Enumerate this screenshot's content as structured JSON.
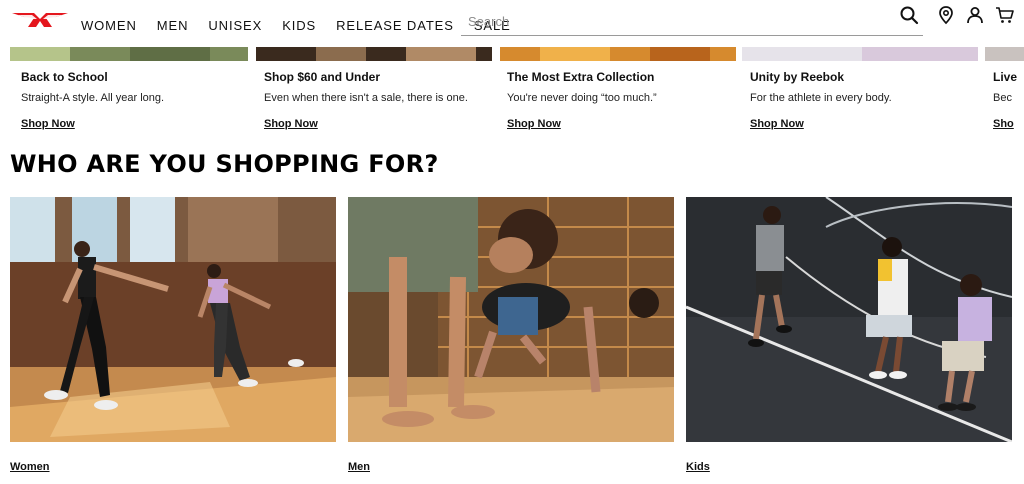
{
  "brand": {
    "logo_alt": "Reebok",
    "accent": "#e4161d"
  },
  "nav": {
    "items": [
      {
        "label": "WOMEN"
      },
      {
        "label": "MEN"
      },
      {
        "label": "UNISEX"
      },
      {
        "label": "KIDS"
      },
      {
        "label": "RELEASE DATES"
      },
      {
        "label": "SALE"
      }
    ]
  },
  "search": {
    "placeholder": "Search",
    "value": ""
  },
  "header_icons": [
    "search-icon",
    "location-pin-icon",
    "user-icon",
    "cart-icon"
  ],
  "collections": [
    {
      "title": "Back to School",
      "subtitle": "Straight-A style. All year long.",
      "link": "Shop Now"
    },
    {
      "title": "Shop $60 and Under",
      "subtitle": "Even when there isn't a sale, there is one.",
      "link": "Shop Now"
    },
    {
      "title": "The Most Extra Collection",
      "subtitle": "You're never doing “too much.”",
      "link": "Shop Now"
    },
    {
      "title": "Unity by Reebok",
      "subtitle": "For the athlete in every body.",
      "link": "Shop Now"
    },
    {
      "title": "Live",
      "subtitle": "Bec",
      "link": "Sho"
    }
  ],
  "section": {
    "title": "WHO ARE YOU SHOPPING FOR?"
  },
  "tiles": [
    {
      "label": "Women"
    },
    {
      "label": "Men"
    },
    {
      "label": "Kids"
    }
  ]
}
